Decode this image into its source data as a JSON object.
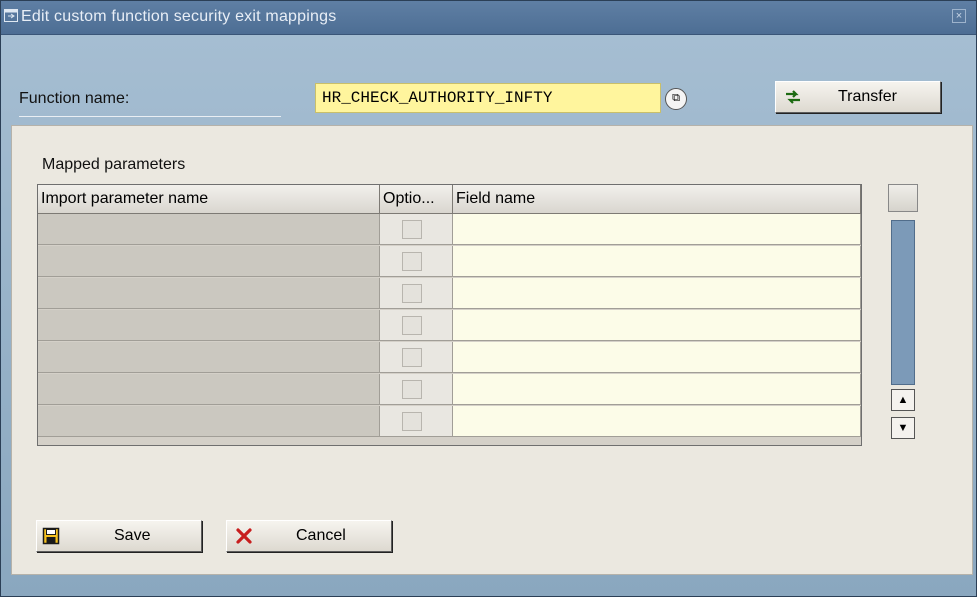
{
  "window": {
    "title": "Edit custom function security exit mappings",
    "close_glyph": "×"
  },
  "function": {
    "label": "Function name:",
    "value": "HR_CHECK_AUTHORITY_INFTY",
    "f4_glyph": "⧉"
  },
  "buttons": {
    "transfer": "Transfer",
    "save": "Save",
    "cancel": "Cancel"
  },
  "table": {
    "group_label": "Mapped parameters",
    "columns": [
      "Import parameter name",
      "Optio...",
      "Field name"
    ],
    "rows": [
      {
        "param": "",
        "optional": false,
        "field": ""
      },
      {
        "param": "",
        "optional": false,
        "field": ""
      },
      {
        "param": "",
        "optional": false,
        "field": ""
      },
      {
        "param": "",
        "optional": false,
        "field": ""
      },
      {
        "param": "",
        "optional": false,
        "field": ""
      },
      {
        "param": "",
        "optional": false,
        "field": ""
      },
      {
        "param": "",
        "optional": false,
        "field": ""
      }
    ]
  },
  "scrollbar": {
    "up_glyph": "▲",
    "down_glyph": "▼"
  },
  "icons": {
    "title": "window-icon",
    "transfer": "transfer-arrow-icon",
    "save": "save-disk-icon",
    "cancel": "cancel-x-icon"
  },
  "colors": {
    "input_highlight": "#fff59d",
    "title_bar": "#4d6e94",
    "panel": "#ebe8e0"
  }
}
